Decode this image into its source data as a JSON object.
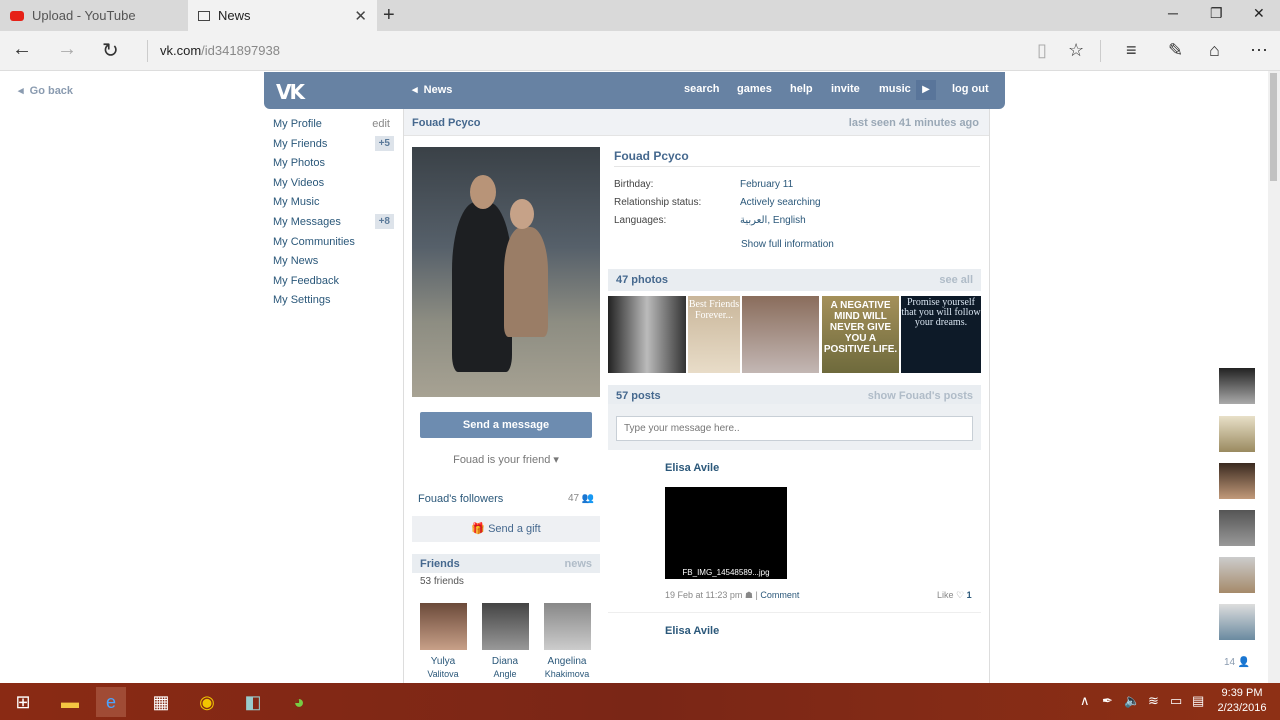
{
  "browser": {
    "tabs": [
      {
        "label": "Upload - YouTube",
        "icon": "youtube-icon"
      },
      {
        "label": "News",
        "icon": "page-icon"
      }
    ],
    "url_host": "vk.com",
    "url_path": "/id341897938"
  },
  "page": {
    "go_back": "Go back",
    "header": {
      "logo": "VK",
      "current": "News",
      "links": [
        "search",
        "games",
        "help",
        "invite",
        "music",
        "log out"
      ]
    },
    "menu": [
      {
        "label": "My Profile",
        "extra": "edit"
      },
      {
        "label": "My Friends",
        "badge": "+5"
      },
      {
        "label": "My Photos"
      },
      {
        "label": "My Videos"
      },
      {
        "label": "My Music"
      },
      {
        "label": "My Messages",
        "badge": "+8"
      },
      {
        "label": "My Communities"
      },
      {
        "label": "My News"
      },
      {
        "label": "My Feedback"
      },
      {
        "label": "My Settings"
      }
    ],
    "profile": {
      "name": "Fouad Pcyco",
      "last_seen": "last seen 41 minutes ago",
      "send_message": "Send a message",
      "friend_status": "Fouad is your friend",
      "followers_label": "Fouad's followers",
      "followers_count": "47",
      "send_gift": "Send a gift",
      "friends_title": "Friends",
      "friends_news": "news",
      "friends_count": "53 friends",
      "friends": [
        {
          "first": "Yulya",
          "last": "Valitova"
        },
        {
          "first": "Diana",
          "last": "Angle"
        },
        {
          "first": "Angelina",
          "last": "Khakimova"
        }
      ],
      "info": [
        {
          "label": "Birthday:",
          "value": "February 11"
        },
        {
          "label": "Relationship status:",
          "value": "Actively searching"
        },
        {
          "label": "Languages:",
          "value": "العربية, English"
        }
      ],
      "show_full": "Show full information",
      "photos_title": "47 photos",
      "photos_see_all": "see all",
      "photo_texts": [
        "",
        "Best Friends Forever...",
        "",
        "A NEGATIVE MIND WILL NEVER GIVE YOU A POSITIVE LIFE.",
        "Promise yourself that you will follow your dreams."
      ],
      "posts_title": "57 posts",
      "posts_show": "show Fouad's posts",
      "message_placeholder": "Type your message here..",
      "post": {
        "author": "Elisa Avile",
        "image_caption": "FB_IMG_14548589...jpg",
        "date": "19 Feb at 11:23 pm",
        "comment": "Comment",
        "like": "Like",
        "like_count": "1"
      },
      "post2_author": "Elisa Avile"
    },
    "rail_count": "14"
  },
  "taskbar": {
    "time": "9:39 PM",
    "date": "2/23/2016"
  }
}
